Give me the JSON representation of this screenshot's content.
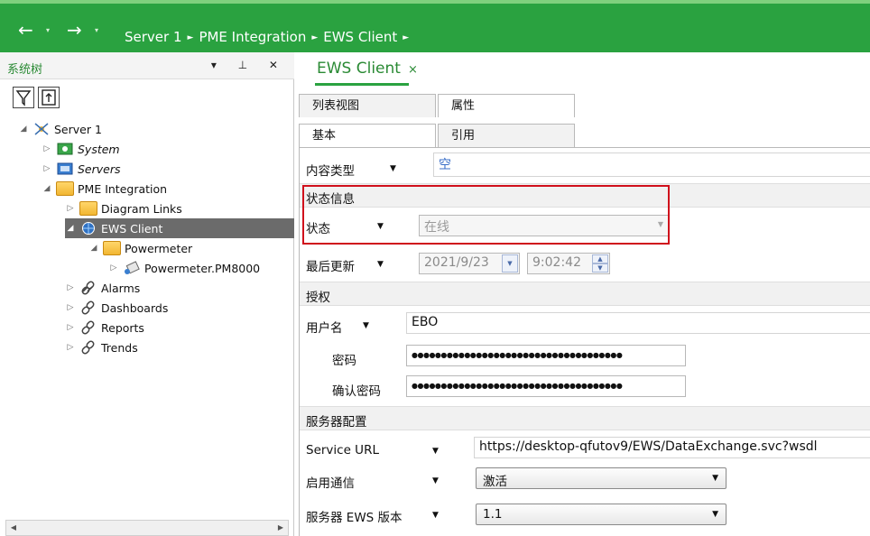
{
  "nav": {
    "back_icon": "back-arrow-icon",
    "forward_icon": "forward-arrow-icon",
    "breadcrumb": [
      "Server 1",
      "PME Integration",
      "EWS Client"
    ],
    "separator": "►"
  },
  "left_pane": {
    "title": "系统树",
    "controls": "▾ ⊥ ✕",
    "tree": [
      {
        "label": "Server 1",
        "italic": false
      },
      {
        "label": "System",
        "italic": true
      },
      {
        "label": "Servers",
        "italic": true
      },
      {
        "label": "PME Integration",
        "italic": false
      },
      {
        "label": "Diagram Links",
        "italic": false
      },
      {
        "label": "EWS Client",
        "italic": false,
        "selected": true
      },
      {
        "label": "Powermeter",
        "italic": false
      },
      {
        "label": "Powermeter.PM8000",
        "italic": false
      },
      {
        "label": "Alarms",
        "italic": false
      },
      {
        "label": "Dashboards",
        "italic": false
      },
      {
        "label": "Reports",
        "italic": false
      },
      {
        "label": "Trends",
        "italic": false
      }
    ]
  },
  "doc_tab": {
    "label": "EWS Client",
    "close": "×"
  },
  "tabs_row1": [
    "列表视图",
    "属性"
  ],
  "tabs_row2": [
    "基本",
    "引用"
  ],
  "props": {
    "content_type_label": "内容类型",
    "content_type_value": "空",
    "status_section": "状态信息",
    "status_label": "状态",
    "status_value": "在线",
    "last_update_label": "最后更新",
    "last_update_date": "2021/9/23",
    "last_update_time": "9:02:42",
    "auth_section": "授权",
    "username_label": "用户名",
    "username_value": "EBO",
    "password_label": "密码",
    "password_value": "●●●●●●●●●●●●●●●●●●●●●●●●●●●●●●●●●●●●",
    "confirm_password_label": "确认密码",
    "confirm_password_value": "●●●●●●●●●●●●●●●●●●●●●●●●●●●●●●●●●●●●",
    "server_section": "服务器配置",
    "service_url_label": "Service URL",
    "service_url_value": "https://desktop-qfutov9/EWS/DataExchange.svc?wsdl",
    "enable_comm_label": "启用通信",
    "enable_comm_value": "激活",
    "ews_version_label": "服务器 EWS 版本",
    "ews_version_value": "1.1"
  },
  "colors": {
    "accent": "#2aa240",
    "highlight": "#d0101c"
  }
}
